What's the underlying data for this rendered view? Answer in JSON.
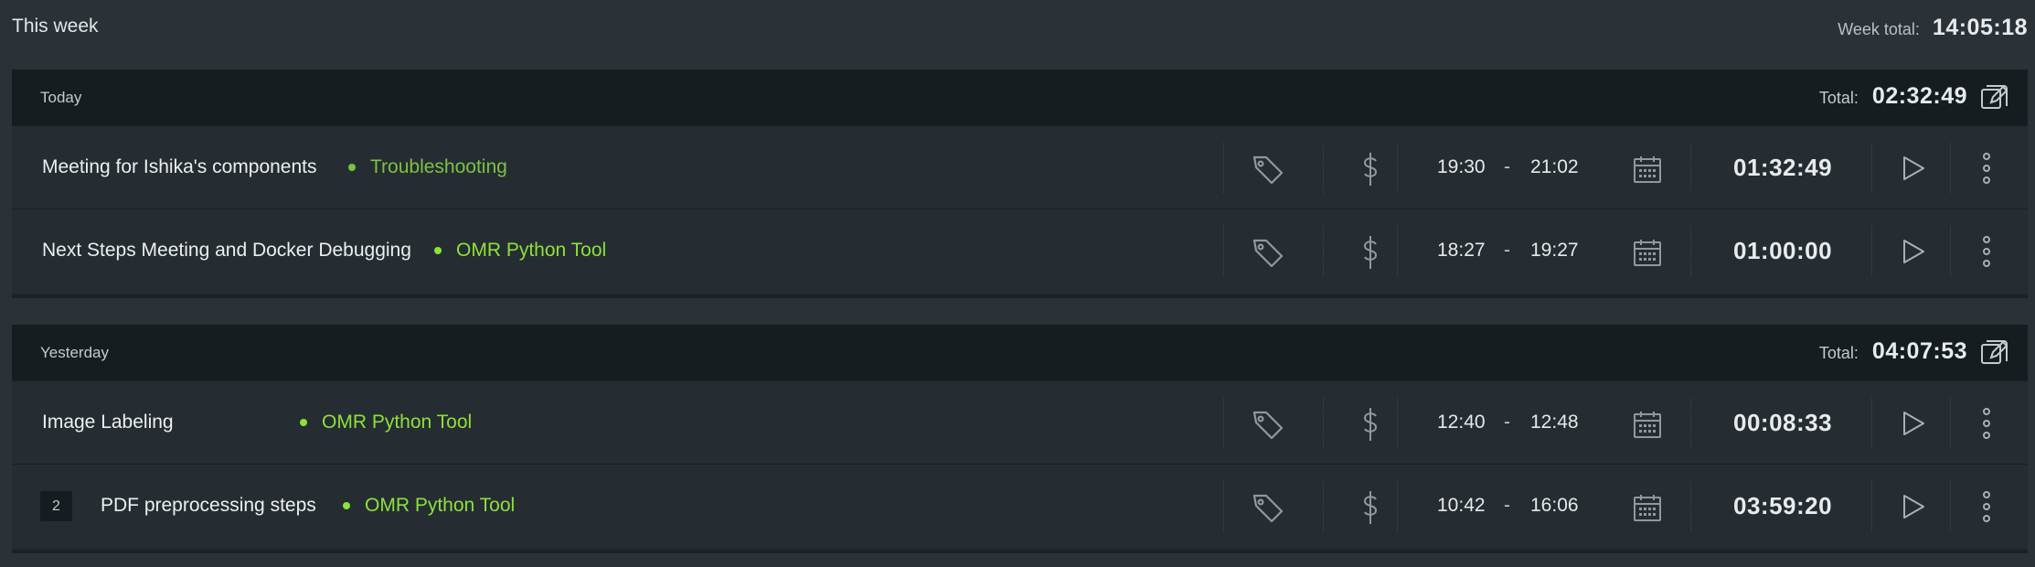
{
  "week": {
    "title": "This week",
    "total_label": "Week total:",
    "total_value": "14:05:18"
  },
  "groups": [
    {
      "label": "Today",
      "total_label": "Total:",
      "total_value": "02:32:49",
      "entries": [
        {
          "badge": "",
          "description": "Meeting for Ishika's components",
          "project": "Troubleshooting",
          "project_color": "#7cc242",
          "start": "19:30",
          "dash": "-",
          "end": "21:02",
          "duration": "01:32:49"
        },
        {
          "badge": "",
          "description": "Next Steps Meeting and Docker Debugging",
          "project": "OMR Python Tool",
          "project_color": "#8ee03b",
          "start": "18:27",
          "dash": "-",
          "end": "19:27",
          "duration": "01:00:00"
        }
      ]
    },
    {
      "label": "Yesterday",
      "total_label": "Total:",
      "total_value": "04:07:53",
      "entries": [
        {
          "badge": "",
          "description": "Image Labeling",
          "project": "OMR Python Tool",
          "project_color": "#8ee03b",
          "start": "12:40",
          "dash": "-",
          "end": "12:48",
          "duration": "00:08:33"
        },
        {
          "badge": "2",
          "description": "PDF preprocessing steps",
          "project": "OMR Python Tool",
          "project_color": "#8ee03b",
          "start": "10:42",
          "dash": "-",
          "end": "16:06",
          "duration": "03:59:20"
        }
      ]
    }
  ],
  "icons": {
    "tag": "tag-icon",
    "billable": "dollar-icon",
    "calendar": "calendar-icon",
    "play": "play-icon",
    "more": "more-vertical-icon",
    "bulk_edit": "bulk-edit-icon"
  },
  "colors": {
    "background": "#2a3238",
    "header_bg": "#161d21",
    "row_bg": "#252d32",
    "project_green": "#8ee03b",
    "project_green_muted": "#7cc242",
    "icon_gray": "#8f999e"
  }
}
